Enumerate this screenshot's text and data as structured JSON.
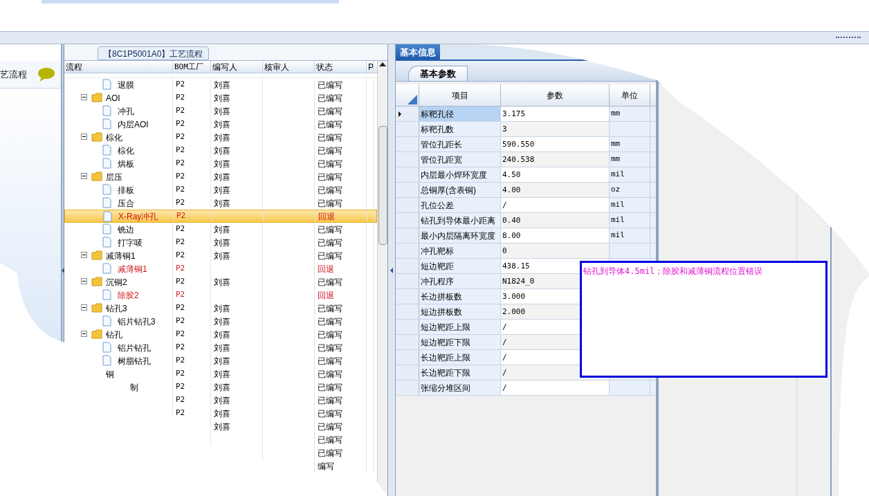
{
  "left_panel": {
    "item": "艺流程"
  },
  "tree_title": "【8C1P5001A0】工艺流程",
  "tree_columns": [
    "流程",
    "BOM工厂",
    "编写人",
    "核审人",
    "状态",
    "P"
  ],
  "tree_rows": [
    {
      "kind": "step",
      "name": "退膜",
      "factory": "P2",
      "writer": "刘喜",
      "status": "已编写",
      "returned": false,
      "selected": false
    },
    {
      "kind": "folder",
      "name": "AOI",
      "factory": "P2",
      "writer": "刘喜",
      "status": "已编写",
      "returned": false,
      "selected": false,
      "children": [
        {
          "kind": "step",
          "name": "冲孔",
          "factory": "P2",
          "writer": "刘喜",
          "status": "已编写",
          "returned": false,
          "selected": false
        },
        {
          "kind": "step",
          "name": "内层AOI",
          "factory": "P2",
          "writer": "刘喜",
          "status": "已编写",
          "returned": false,
          "selected": false
        }
      ]
    },
    {
      "kind": "folder",
      "name": "棕化",
      "factory": "P2",
      "writer": "刘喜",
      "status": "已编写",
      "returned": false,
      "selected": false,
      "children": [
        {
          "kind": "step",
          "name": "棕化",
          "factory": "P2",
          "writer": "刘喜",
          "status": "已编写",
          "returned": false,
          "selected": false
        },
        {
          "kind": "step",
          "name": "烘板",
          "factory": "P2",
          "writer": "刘喜",
          "status": "已编写",
          "returned": false,
          "selected": false
        }
      ]
    },
    {
      "kind": "folder",
      "name": "层压",
      "factory": "P2",
      "writer": "刘喜",
      "status": "已编写",
      "returned": false,
      "selected": false,
      "children": [
        {
          "kind": "step",
          "name": "排板",
          "factory": "P2",
          "writer": "刘喜",
          "status": "已编写",
          "returned": false,
          "selected": false
        },
        {
          "kind": "step",
          "name": "压合",
          "factory": "P2",
          "writer": "刘喜",
          "status": "已编写",
          "returned": false,
          "selected": false
        },
        {
          "kind": "step",
          "name": "X-Ray冲孔",
          "factory": "P2",
          "status": "回退",
          "returned": true,
          "selected": true
        },
        {
          "kind": "step",
          "name": "铣边",
          "factory": "P2",
          "writer": "刘喜",
          "status": "已编写",
          "returned": false,
          "selected": false
        },
        {
          "kind": "step",
          "name": "打字唛",
          "factory": "P2",
          "writer": "刘喜",
          "status": "已编写",
          "returned": false,
          "selected": false
        }
      ]
    },
    {
      "kind": "folder",
      "name": "减薄铜1",
      "factory": "P2",
      "writer": "刘喜",
      "status": "已编写",
      "returned": false,
      "selected": false,
      "children": [
        {
          "kind": "step",
          "name": "减薄铜1",
          "factory": "P2",
          "status": "回退",
          "returned": true,
          "selected": false
        }
      ]
    },
    {
      "kind": "folder",
      "name": "沉铜2",
      "factory": "P2",
      "writer": "刘喜",
      "status": "已编写",
      "returned": false,
      "selected": false,
      "children": [
        {
          "kind": "step",
          "name": "除胶2",
          "factory": "P2",
          "status": "回退",
          "returned": true,
          "selected": false
        }
      ]
    },
    {
      "kind": "folder",
      "name": "钻孔3",
      "factory": "P2",
      "writer": "刘喜",
      "status": "已编写",
      "returned": false,
      "selected": false,
      "children": [
        {
          "kind": "step",
          "name": "铝片钻孔3",
          "factory": "P2",
          "writer": "刘喜",
          "status": "已编写",
          "returned": false,
          "selected": false
        }
      ]
    },
    {
      "kind": "folder",
      "name": "钻孔",
      "factory": "P2",
      "writer": "刘喜",
      "status": "已编写",
      "returned": false,
      "selected": false,
      "children": [
        {
          "kind": "step",
          "name": "铝片钻孔",
          "factory": "P2",
          "writer": "刘喜",
          "status": "已编写",
          "returned": false,
          "selected": false
        },
        {
          "kind": "step",
          "name": "树脂钻孔",
          "factory": "P2",
          "writer": "刘喜",
          "status": "已编写",
          "returned": false,
          "selected": false
        }
      ]
    },
    {
      "kind": "cut",
      "name": "铜",
      "factory": "P2",
      "writer": "刘喜",
      "status": "已编写",
      "returned": false,
      "selected": false,
      "children": [
        {
          "kind": "cut",
          "name": "制",
          "factory": "P2",
          "writer": "刘喜",
          "status": "已编写",
          "returned": false,
          "selected": false
        },
        {
          "kind": "cut",
          "factory": "P2",
          "writer": "刘喜",
          "status": "已编写",
          "returned": false,
          "selected": false
        },
        {
          "kind": "cut",
          "factory": "P2",
          "writer": "刘喜",
          "status": "已编写",
          "returned": false,
          "selected": false
        },
        {
          "kind": "cut",
          "writer": "刘喜",
          "status": "已编写",
          "returned": false,
          "selected": false
        },
        {
          "kind": "cut",
          "status": "已编写",
          "returned": false,
          "selected": false
        },
        {
          "kind": "cut",
          "status": "已编写",
          "returned": false,
          "selected": false
        },
        {
          "kind": "cut",
          "status": "编写",
          "returned": false,
          "selected": false
        }
      ]
    }
  ],
  "tabs": [
    {
      "label": "基本信息",
      "selected": true
    }
  ],
  "sub_tabs": [
    {
      "label": "基本参数",
      "selected": true
    }
  ],
  "param_columns": [
    "项目",
    "参数",
    "单位"
  ],
  "params": [
    {
      "item": "标靶孔径",
      "value": "3.175",
      "unit": "mm",
      "selected": true
    },
    {
      "item": "标靶孔数",
      "value": "3",
      "selected": false
    },
    {
      "item": "管位孔距长",
      "value": "590.550",
      "unit": "mm",
      "selected": false
    },
    {
      "item": "管位孔距宽",
      "value": "240.538",
      "unit": "mm",
      "selected": false
    },
    {
      "item": "内层最小焊环宽度",
      "value": "4.50",
      "unit": "mil",
      "selected": false
    },
    {
      "item": "总铜厚(含表铜)",
      "value": "4.00",
      "unit": "oz",
      "selected": false
    },
    {
      "item": "孔位公差",
      "value": "/",
      "unit": "mil",
      "selected": false
    },
    {
      "item": "钻孔到导体最小距离",
      "value": "0.40",
      "unit": "mil",
      "selected": false
    },
    {
      "item": "最小内层隔离环宽度",
      "value": "8.00",
      "unit": "mil",
      "selected": false
    },
    {
      "item": "冲孔靶标",
      "value": "0",
      "selected": false
    },
    {
      "item": "短边靶距",
      "value": "438.15",
      "selected": false
    },
    {
      "item": "冲孔程序",
      "value": "N1824_0",
      "selected": false
    },
    {
      "item": "长边拼板数",
      "value": "3.000",
      "selected": false
    },
    {
      "item": "短边拼板数",
      "value": "2.000",
      "selected": false
    },
    {
      "item": "短边靶距上限",
      "value": "/",
      "selected": false
    },
    {
      "item": "短边靶距下限",
      "value": "/",
      "selected": false
    },
    {
      "item": "长边靶距上限",
      "value": "/",
      "selected": false
    },
    {
      "item": "长边靶距下限",
      "value": "/",
      "selected": false
    },
    {
      "item": "张缩分堆区间",
      "value": "/",
      "selected": false
    }
  ],
  "note": {
    "text": "钻孔到导体4.5mil；除胶和减薄铜流程位置错误"
  }
}
